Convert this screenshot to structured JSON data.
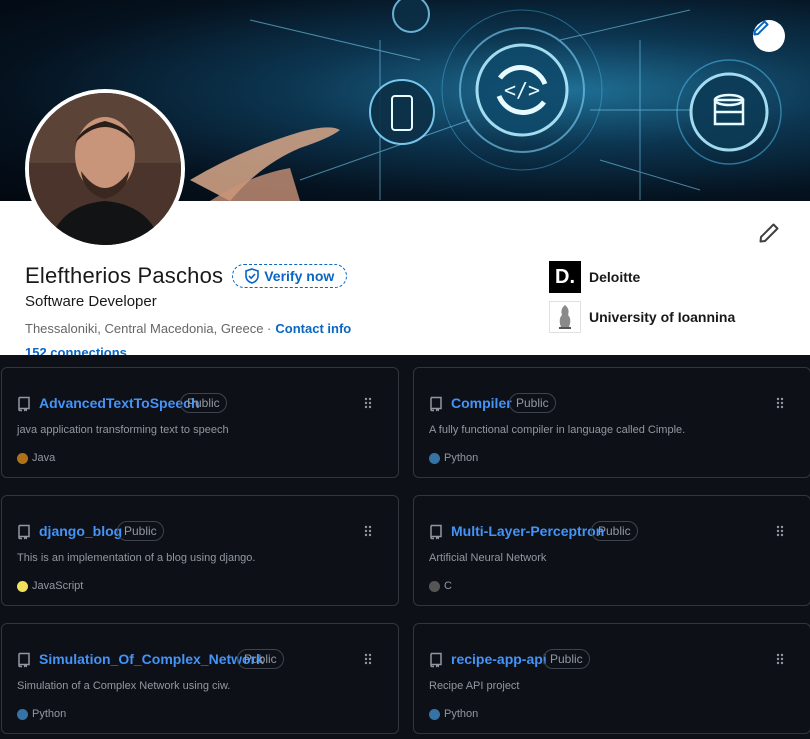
{
  "profile": {
    "name": "Eleftherios Paschos",
    "verify_label": "Verify now",
    "headline": "Software Developer",
    "location": "Thessaloniki, Central Macedonia, Greece ·",
    "contact_label": "Contact info",
    "connections": "152 connections",
    "experience": [
      {
        "name": "Deloitte",
        "logo_text": "D."
      },
      {
        "name": "University of Ioannina"
      }
    ]
  },
  "repos": [
    {
      "name": "AdvancedTextToSpeech",
      "visibility": "Public",
      "description": "java application transforming text to speech",
      "language": "Java",
      "color": "#b07219"
    },
    {
      "name": "Compiler",
      "visibility": "Public",
      "description": "A fully functional compiler in language called Cimple.",
      "language": "Python",
      "color": "#3572A5"
    },
    {
      "name": "django_blog",
      "visibility": "Public",
      "description": "This is an implementation of a blog using django.",
      "language": "JavaScript",
      "color": "#f1e05a"
    },
    {
      "name": "Multi-Layer-Perceptron",
      "visibility": "Public",
      "description": "Artificial Neural Network",
      "language": "C",
      "color": "#555555"
    },
    {
      "name": "Simulation_Of_Complex_Network",
      "visibility": "Public",
      "description": "Simulation of a Complex Network using ciw.",
      "language": "Python",
      "color": "#3572A5"
    },
    {
      "name": "recipe-app-api",
      "visibility": "Public",
      "description": "Recipe API project",
      "language": "Python",
      "color": "#3572A5"
    }
  ]
}
